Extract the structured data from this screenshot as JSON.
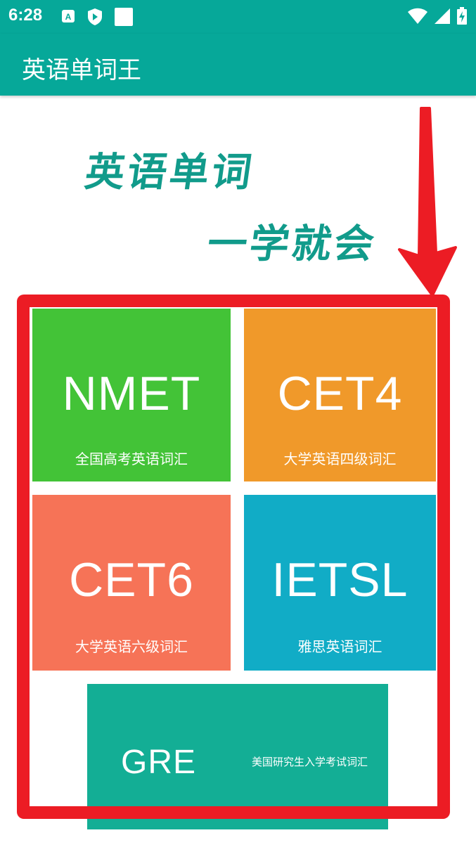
{
  "status_bar": {
    "time": "6:28",
    "left_icons": [
      "a-letter-notification-icon",
      "play-protect-icon",
      "square-notification-icon"
    ],
    "right_icons": [
      "wifi-icon",
      "signal-icon",
      "battery-charging-icon"
    ]
  },
  "app_bar": {
    "title": "英语单词王"
  },
  "banner": {
    "line1": "英语单词",
    "line2": "一学就会"
  },
  "tiles": [
    {
      "code": "NMET",
      "desc": "全国高考英语词汇",
      "color": "#43c337"
    },
    {
      "code": "CET4",
      "desc": "大学英语四级词汇",
      "color": "#f0992a"
    },
    {
      "code": "CET6",
      "desc": "大学英语六级词汇",
      "color": "#f67357"
    },
    {
      "code": "IETSL",
      "desc": "雅思英语词汇",
      "color": "#11acc6"
    },
    {
      "code": "GRE",
      "desc": "美国研究生入学考试词汇",
      "color": "#13ae95"
    }
  ],
  "annotation": {
    "color": "#ec1c24",
    "icons": [
      "down-arrow-icon",
      "highlight-box"
    ]
  },
  "theme": {
    "primary": "#06a899",
    "slogan_color": "#119b8b"
  }
}
